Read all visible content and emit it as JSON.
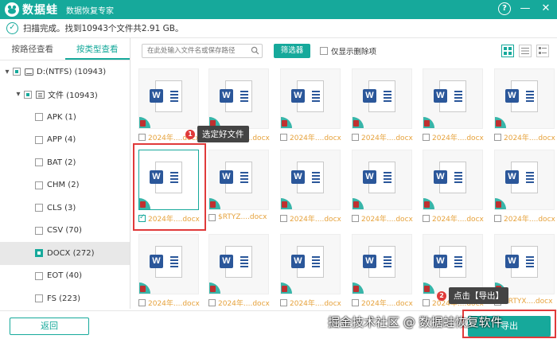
{
  "app": {
    "logo_glyph": "🐸",
    "name": "数据蛙",
    "subtitle": "数据恢复专家",
    "help_glyph": "?",
    "minimize_glyph": "—",
    "close_glyph": "✕"
  },
  "status": {
    "text": "扫描完成。找到10943个文件共2.91 GB。",
    "check_glyph": "✓"
  },
  "sidebar": {
    "tabs": [
      {
        "label": "按路径查看",
        "active": false
      },
      {
        "label": "按类型查看",
        "active": true
      }
    ],
    "tree": [
      {
        "label": "D:(NTFS) (10943)",
        "level": 0,
        "icon": "drive-icon",
        "expand": "▾",
        "check": "partial"
      },
      {
        "label": "文件 (10943)",
        "level": 1,
        "icon": "folder-icon",
        "expand": "▾",
        "check": "partial"
      },
      {
        "label": "APK (1)",
        "level": 2,
        "check": "none"
      },
      {
        "label": "APP (4)",
        "level": 2,
        "check": "none"
      },
      {
        "label": "BAT (2)",
        "level": 2,
        "check": "none"
      },
      {
        "label": "CHM (2)",
        "level": 2,
        "check": "none"
      },
      {
        "label": "CLS (3)",
        "level": 2,
        "check": "none"
      },
      {
        "label": "CSV (70)",
        "level": 2,
        "check": "none"
      },
      {
        "label": "DOCX (272)",
        "level": 2,
        "check": "full",
        "selected": true
      },
      {
        "label": "EOT (40)",
        "level": 2,
        "check": "none"
      },
      {
        "label": "FS (223)",
        "level": 2,
        "check": "none"
      }
    ]
  },
  "toolbar": {
    "search_placeholder": "在此处输入文件名或保存路径",
    "filter_label": "筛选器",
    "only_deleted_label": "仅显示删除项"
  },
  "files": [
    {
      "name": "2024年....docx",
      "checked": false
    },
    {
      "name": "2024年....docx",
      "checked": false
    },
    {
      "name": "2024年....docx",
      "checked": false
    },
    {
      "name": "2024年....docx",
      "checked": false
    },
    {
      "name": "2024年....docx",
      "checked": false
    },
    {
      "name": "2024年....docx",
      "checked": false
    },
    {
      "name": "2024年....docx",
      "checked": true
    },
    {
      "name": "$RTYZ....docx",
      "checked": false
    },
    {
      "name": "2024年....docx",
      "checked": false
    },
    {
      "name": "2024年....docx",
      "checked": false
    },
    {
      "name": "2024年....docx",
      "checked": false
    },
    {
      "name": "2024年....docx",
      "checked": false
    },
    {
      "name": "2024年....docx",
      "checked": false
    },
    {
      "name": "2024年....docx",
      "checked": false
    },
    {
      "name": "2024年....docx",
      "checked": false
    },
    {
      "name": "2024年....docx",
      "checked": false
    },
    {
      "name": "2024年....docx",
      "checked": false
    },
    {
      "name": "$RTYX....docx",
      "checked": false
    }
  ],
  "doc_badge": "W",
  "annotations": {
    "step1_num": "1",
    "step1_label": "选定好文件",
    "step2_num": "2",
    "step2_label": "点击【导出】"
  },
  "footer": {
    "back_label": "返回",
    "export_label": "导出"
  },
  "watermark": "掘金技术社区 @ 数据蛙恢复软件",
  "colors": {
    "accent": "#16a99b",
    "annotation_red": "#e03a3a",
    "filename_orange": "#e6a23c",
    "word_blue": "#2b579a"
  }
}
